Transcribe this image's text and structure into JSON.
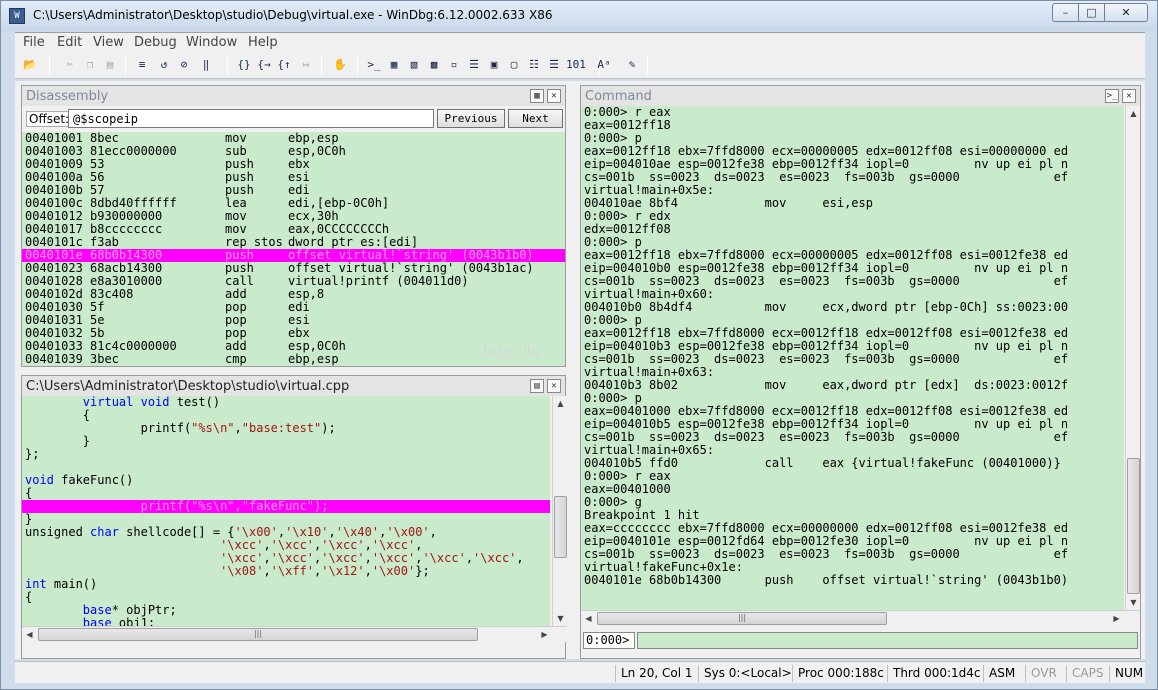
{
  "window": {
    "title": "C:\\Users\\Administrator\\Desktop\\studio\\Debug\\virtual.exe - WinDbg:6.12.0002.633 X86"
  },
  "menu": [
    "File",
    "Edit",
    "View",
    "Debug",
    "Window",
    "Help"
  ],
  "toolbar_icons": [
    "open-icon",
    "cut-icon",
    "copy-icon",
    "paste-icon",
    "go-icon",
    "restart-icon",
    "stop-icon",
    "break-icon",
    "step-into-icon",
    "step-over-icon",
    "step-out-icon",
    "run-to-cursor-icon",
    "insert-breakpoint-icon",
    "command-window-icon",
    "watch-window-icon",
    "locals-window-icon",
    "registers-window-icon",
    "memory-window-icon",
    "call-stack-icon",
    "disassembly-window-icon",
    "scratch-pad-icon",
    "processes-threads-icon",
    "source-mode-icon",
    "hex-icon",
    "font-icon",
    "options-icon"
  ],
  "disassembly": {
    "title": "Disassembly",
    "offset_label": "Offset:",
    "offset_value": "@$scopeip",
    "previous_label": "Previous",
    "next_label": "Next",
    "rows": [
      {
        "addr": "00401001",
        "bytes": "8bec",
        "op": "mov",
        "args": "ebp,esp"
      },
      {
        "addr": "00401003",
        "bytes": "81ecc0000000",
        "op": "sub",
        "args": "esp,0C0h"
      },
      {
        "addr": "00401009",
        "bytes": "53",
        "op": "push",
        "args": "ebx"
      },
      {
        "addr": "0040100a",
        "bytes": "56",
        "op": "push",
        "args": "esi"
      },
      {
        "addr": "0040100b",
        "bytes": "57",
        "op": "push",
        "args": "edi"
      },
      {
        "addr": "0040100c",
        "bytes": "8dbd40ffffff",
        "op": "lea",
        "args": "edi,[ebp-0C0h]"
      },
      {
        "addr": "00401012",
        "bytes": "b930000000",
        "op": "mov",
        "args": "ecx,30h"
      },
      {
        "addr": "00401017",
        "bytes": "b8cccccccc",
        "op": "mov",
        "args": "eax,0CCCCCCCCh"
      },
      {
        "addr": "0040101c",
        "bytes": "f3ab",
        "op": "rep stos",
        "args": "dword ptr es:[edi]"
      },
      {
        "addr": "0040101e",
        "bytes": "68b0b14300",
        "op": "push",
        "args": "offset virtual!`string' (0043b1b0)",
        "highlight": true
      },
      {
        "addr": "00401023",
        "bytes": "68acb14300",
        "op": "push",
        "args": "offset virtual!`string' (0043b1ac)"
      },
      {
        "addr": "00401028",
        "bytes": "e8a3010000",
        "op": "call",
        "args": "virtual!printf (004011d0)"
      },
      {
        "addr": "0040102d",
        "bytes": "83c408",
        "op": "add",
        "args": "esp,8"
      },
      {
        "addr": "00401030",
        "bytes": "5f",
        "op": "pop",
        "args": "edi"
      },
      {
        "addr": "00401031",
        "bytes": "5e",
        "op": "pop",
        "args": "esi"
      },
      {
        "addr": "00401032",
        "bytes": "5b",
        "op": "pop",
        "args": "ebx"
      },
      {
        "addr": "00401033",
        "bytes": "81c4c0000000",
        "op": "add",
        "args": "esp,0C0h"
      },
      {
        "addr": "00401039",
        "bytes": "3bec",
        "op": "cmp",
        "args": "ebp,esp"
      }
    ]
  },
  "source": {
    "title": "C:\\Users\\Administrator\\Desktop\\studio\\virtual.cpp",
    "lines": [
      [
        [
          "plain",
          "        "
        ],
        [
          "kw",
          "virtual void"
        ],
        [
          "plain",
          " test()"
        ]
      ],
      [
        [
          "plain",
          "        {"
        ]
      ],
      [
        [
          "plain",
          "                printf("
        ],
        [
          "str",
          "\"%s\\n\""
        ],
        [
          "plain",
          ","
        ],
        [
          "str",
          "\"base:test\""
        ],
        [
          "plain",
          ");"
        ]
      ],
      [
        [
          "plain",
          "        }"
        ]
      ],
      [
        [
          "plain",
          "};"
        ]
      ],
      [
        [
          "plain",
          ""
        ]
      ],
      [
        [
          "kw",
          "void"
        ],
        [
          "plain",
          " fakeFunc()"
        ]
      ],
      [
        [
          "plain",
          "{"
        ]
      ],
      [
        [
          "plain",
          "                printf(\"%s\\n\",\"fakeFunc\");"
        ]
      ],
      [
        [
          "plain",
          "}"
        ]
      ],
      [
        [
          "plain",
          "unsigned "
        ],
        [
          "kw",
          "char"
        ],
        [
          "plain",
          " shellcode[] = {"
        ],
        [
          "str",
          "'\\x00'"
        ],
        [
          "plain",
          ","
        ],
        [
          "str",
          "'\\x10'"
        ],
        [
          "plain",
          ","
        ],
        [
          "str",
          "'\\x40'"
        ],
        [
          "plain",
          ","
        ],
        [
          "str",
          "'\\x00'"
        ],
        [
          "plain",
          ","
        ]
      ],
      [
        [
          "plain",
          "                           "
        ],
        [
          "str",
          "'\\xcc'"
        ],
        [
          "plain",
          ","
        ],
        [
          "str",
          "'\\xcc'"
        ],
        [
          "plain",
          ","
        ],
        [
          "str",
          "'\\xcc'"
        ],
        [
          "plain",
          ","
        ],
        [
          "str",
          "'\\xcc'"
        ],
        [
          "plain",
          ","
        ]
      ],
      [
        [
          "plain",
          "                           "
        ],
        [
          "str",
          "'\\xcc'"
        ],
        [
          "plain",
          ","
        ],
        [
          "str",
          "'\\xcc'"
        ],
        [
          "plain",
          ","
        ],
        [
          "str",
          "'\\xcc'"
        ],
        [
          "plain",
          ","
        ],
        [
          "str",
          "'\\xcc'"
        ],
        [
          "plain",
          ","
        ],
        [
          "str",
          "'\\xcc'"
        ],
        [
          "plain",
          ","
        ],
        [
          "str",
          "'\\xcc'"
        ],
        [
          "plain",
          ","
        ]
      ],
      [
        [
          "plain",
          "                           "
        ],
        [
          "str",
          "'\\x08'"
        ],
        [
          "plain",
          ","
        ],
        [
          "str",
          "'\\xff'"
        ],
        [
          "plain",
          ","
        ],
        [
          "str",
          "'\\x12'"
        ],
        [
          "plain",
          ","
        ],
        [
          "str",
          "'\\x00'"
        ],
        [
          "plain",
          "};"
        ]
      ],
      [
        [
          "kw",
          "int"
        ],
        [
          "plain",
          " main()"
        ]
      ],
      [
        [
          "plain",
          "{"
        ]
      ],
      [
        [
          "plain",
          "        "
        ],
        [
          "kw",
          "base"
        ],
        [
          "plain",
          "* objPtr;"
        ]
      ],
      [
        [
          "plain",
          "        "
        ],
        [
          "kw",
          "base"
        ],
        [
          "plain",
          " obj1;"
        ]
      ]
    ],
    "highlight_line": 8
  },
  "command": {
    "title": "Command",
    "lines": [
      "0:000> r eax",
      "eax=0012ff18",
      "0:000> p",
      "eax=0012ff18 ebx=7ffd8000 ecx=00000005 edx=0012ff08 esi=00000000 ed",
      "eip=004010ae esp=0012fe38 ebp=0012ff34 iopl=0         nv up ei pl n",
      "cs=001b  ss=0023  ds=0023  es=0023  fs=003b  gs=0000             ef",
      "virtual!main+0x5e:",
      "004010ae 8bf4            mov     esi,esp",
      "0:000> r edx",
      "edx=0012ff08",
      "0:000> p",
      "eax=0012ff18 ebx=7ffd8000 ecx=00000005 edx=0012ff08 esi=0012fe38 ed",
      "eip=004010b0 esp=0012fe38 ebp=0012ff34 iopl=0         nv up ei pl n",
      "cs=001b  ss=0023  ds=0023  es=0023  fs=003b  gs=0000             ef",
      "virtual!main+0x60:",
      "004010b0 8b4df4          mov     ecx,dword ptr [ebp-0Ch] ss:0023:00",
      "0:000> p",
      "eax=0012ff18 ebx=7ffd8000 ecx=0012ff18 edx=0012ff08 esi=0012fe38 ed",
      "eip=004010b3 esp=0012fe38 ebp=0012ff34 iopl=0         nv up ei pl n",
      "cs=001b  ss=0023  ds=0023  es=0023  fs=003b  gs=0000             ef",
      "virtual!main+0x63:",
      "004010b3 8b02            mov     eax,dword ptr [edx]  ds:0023:0012f",
      "0:000> p",
      "eax=00401000 ebx=7ffd8000 ecx=0012ff18 edx=0012ff08 esi=0012fe38 ed",
      "eip=004010b5 esp=0012fe38 ebp=0012ff34 iopl=0         nv up ei pl n",
      "cs=001b  ss=0023  ds=0023  es=0023  fs=003b  gs=0000             ef",
      "virtual!main+0x65:",
      "004010b5 ffd0            call    eax {virtual!fakeFunc (00401000)}",
      "0:000> r eax",
      "eax=00401000",
      "0:000> g",
      "Breakpoint 1 hit",
      "eax=cccccccc ebx=7ffd8000 ecx=00000000 edx=0012ff08 esi=0012fe38 ed",
      "eip=0040101e esp=0012fd64 ebp=0012fe30 iopl=0         nv up ei pl n",
      "cs=001b  ss=0023  ds=0023  es=0023  fs=003b  gs=0000             ef",
      "virtual!fakeFunc+0x1e:",
      "0040101e 68b0b14300      push    offset virtual!`string' (0043b1b0)"
    ],
    "prompt": "0:000>",
    "input_value": ""
  },
  "watermark": "http://bl",
  "status": {
    "position": "Ln 20, Col 1",
    "sys": "Sys 0:<Local>",
    "proc": "Proc 000:188c",
    "thrd": "Thrd 000:1d4c",
    "asm": "ASM",
    "ovr": "OVR",
    "caps": "CAPS",
    "num": "NUM"
  },
  "colors": {
    "window_bg": "#c9ebcc",
    "highlight": "#ff00ff",
    "highlight_text": "#ff9cff",
    "keyword": "#0000ff",
    "string": "#a31515"
  }
}
